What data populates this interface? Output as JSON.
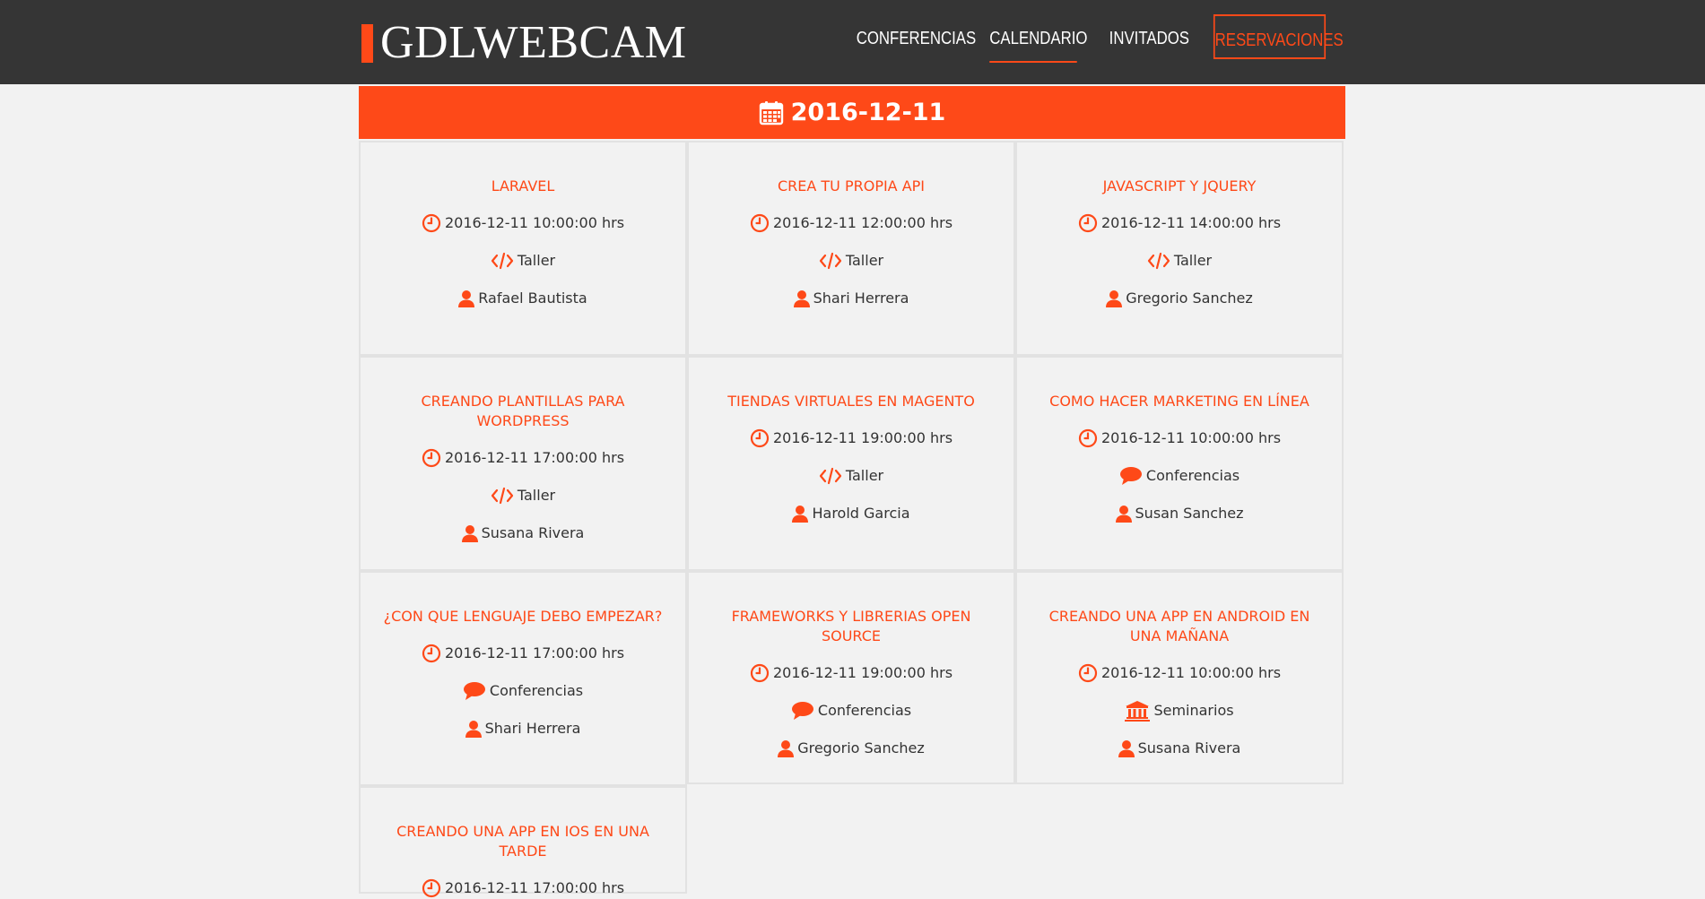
{
  "brand": {
    "name": "GDLWEBCAM",
    "accent": "#fe4918",
    "header_bg": "#353535"
  },
  "nav": {
    "items": [
      {
        "label": "CONFERENCIAS"
      },
      {
        "label": "CALENDARIO",
        "active": true
      },
      {
        "label": "INVITADOS"
      },
      {
        "label": "RESERVACIONES",
        "cta": true
      }
    ]
  },
  "calendar": {
    "date": "2016-12-11",
    "icon": "calendar-icon"
  },
  "events": [
    {
      "title": "LARAVEL",
      "datetime": "2016-12-11 10:00:00 hrs",
      "category": "Taller",
      "category_icon": "code-icon",
      "speaker": "Rafael Bautista"
    },
    {
      "title": "CREA TU PROPIA API",
      "datetime": "2016-12-11 12:00:00 hrs",
      "category": "Taller",
      "category_icon": "code-icon",
      "speaker": "Shari Herrera"
    },
    {
      "title": "JAVASCRIPT Y JQUERY",
      "datetime": "2016-12-11 14:00:00 hrs",
      "category": "Taller",
      "category_icon": "code-icon",
      "speaker": "Gregorio Sanchez"
    },
    {
      "title": "CREANDO PLANTILLAS PARA WORDPRESS",
      "datetime": "2016-12-11 17:00:00 hrs",
      "category": "Taller",
      "category_icon": "code-icon",
      "speaker": "Susana Rivera"
    },
    {
      "title": "TIENDAS VIRTUALES EN MAGENTO",
      "datetime": "2016-12-11 19:00:00 hrs",
      "category": "Taller",
      "category_icon": "code-icon",
      "speaker": "Harold Garcia"
    },
    {
      "title": "COMO HACER MARKETING EN LÍNEA",
      "datetime": "2016-12-11 10:00:00 hrs",
      "category": "Conferencias",
      "category_icon": "comment-icon",
      "speaker": "Susan Sanchez"
    },
    {
      "title": "¿CON QUE LENGUAJE DEBO EMPEZAR?",
      "datetime": "2016-12-11 17:00:00 hrs",
      "category": "Conferencias",
      "category_icon": "comment-icon",
      "speaker": "Shari Herrera"
    },
    {
      "title": "FRAMEWORKS Y LIBRERIAS OPEN SOURCE",
      "datetime": "2016-12-11 19:00:00 hrs",
      "category": "Conferencias",
      "category_icon": "comment-icon",
      "speaker": "Gregorio Sanchez"
    },
    {
      "title": "CREANDO UNA APP EN ANDROID EN UNA MAÑANA",
      "datetime": "2016-12-11 10:00:00 hrs",
      "category": "Seminarios",
      "category_icon": "university-icon",
      "speaker": "Susana Rivera"
    },
    {
      "title": "CREANDO UNA APP EN IOS EN UNA TARDE",
      "datetime": "2016-12-11 17:00:00 hrs"
    }
  ]
}
